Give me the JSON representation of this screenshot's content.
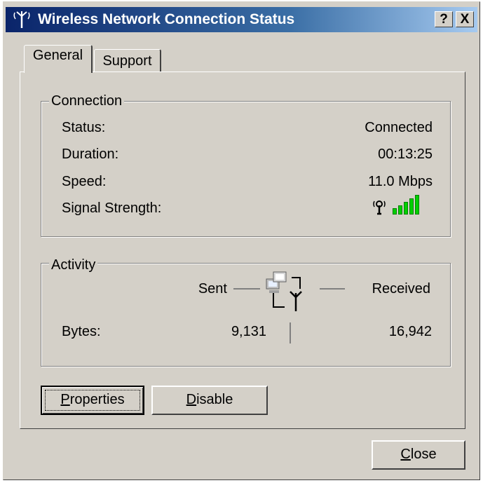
{
  "window": {
    "title": "Wireless Network Connection Status",
    "help_button": "?",
    "close_x": "X",
    "colors": {
      "titlebar_start": "#0a246a",
      "titlebar_end": "#a6caf0",
      "face": "#d4d0c8",
      "signal": "#00d000"
    }
  },
  "tabs": [
    {
      "label": "General",
      "selected": true
    },
    {
      "label": "Support",
      "selected": false
    }
  ],
  "connection": {
    "legend": "Connection",
    "status_label": "Status:",
    "status_value": "Connected",
    "duration_label": "Duration:",
    "duration_value": "00:13:25",
    "speed_label": "Speed:",
    "speed_value": "11.0 Mbps",
    "signal_label": "Signal Strength:",
    "signal_bars_lit": 5,
    "signal_bars_total": 5,
    "signal_icon": "antenna-icon"
  },
  "activity": {
    "legend": "Activity",
    "sent_label": "Sent",
    "received_label": "Received",
    "bytes_label": "Bytes:",
    "bytes_sent": "9,131",
    "bytes_received": "16,942",
    "icon": "network-activity-icon"
  },
  "buttons": {
    "properties_mnemonic": "P",
    "properties_rest": "roperties",
    "disable_mnemonic": "D",
    "disable_rest": "isable",
    "close_mnemonic": "C",
    "close_rest": "lose"
  }
}
